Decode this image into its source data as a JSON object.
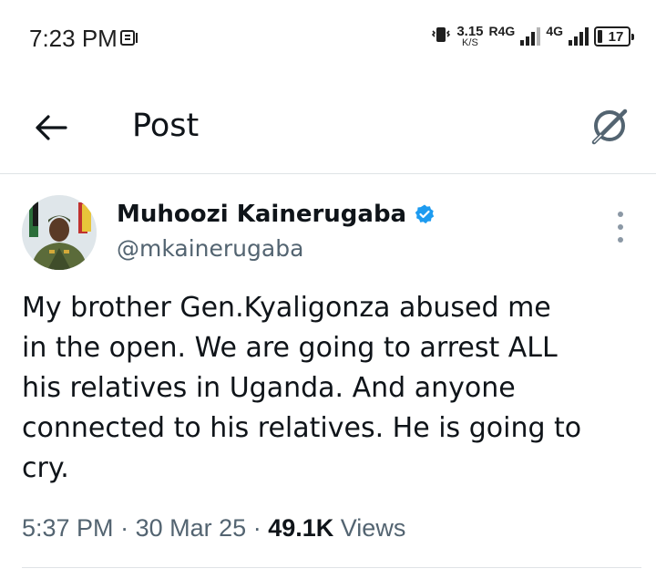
{
  "status_bar": {
    "time": "7:23 PM",
    "speed_value": "3.15",
    "speed_unit": "K/S",
    "network_1": "R4G",
    "network_2": "4G",
    "battery": "17"
  },
  "header": {
    "title": "Post",
    "back_icon": "arrow-left-icon",
    "grok_icon": "grok-icon"
  },
  "post": {
    "author_name": "Muhoozi Kainerugaba",
    "handle": "@mkainerugaba",
    "verified": true,
    "text_lines": [
      "My brother Gen.Kyaligonza abused me",
      "in the open. We are going to arrest ALL",
      "his relatives in Uganda. And anyone",
      "connected to his relatives. He is going to",
      "cry."
    ],
    "time": "5:37 PM",
    "separator": "·",
    "date": "30 Mar 25",
    "views_count": "49.1K",
    "views_label": "Views"
  },
  "colors": {
    "text": "#0f1419",
    "secondary": "#536471",
    "verified": "#1d9bf0",
    "divider": "#dfe3e6"
  }
}
